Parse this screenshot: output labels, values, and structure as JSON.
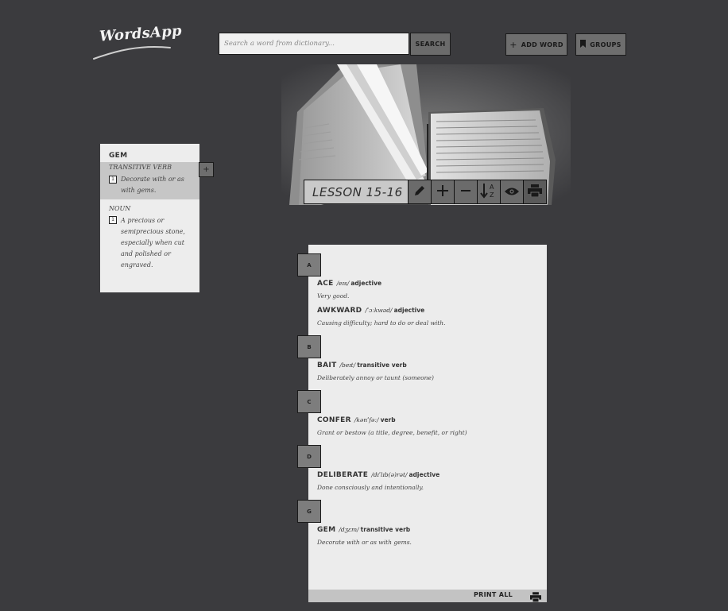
{
  "app": {
    "name": "WordsApp"
  },
  "search": {
    "placeholder": "Search a word from dictionary...",
    "button_label": "SEARCH"
  },
  "toolbar": {
    "add_word_label": "ADD WORD",
    "groups_label": "GROUPS"
  },
  "lesson": {
    "title": "LESSON 15-16",
    "actions": [
      "pencil-icon",
      "plus-icon",
      "minus-icon",
      "sort-az-icon",
      "eye-icon",
      "print-icon"
    ]
  },
  "popup": {
    "word": "GEM",
    "senses": [
      {
        "pos": "TRANSITIVE VERB",
        "num": "1",
        "definition": "Decorate with or as with gems."
      },
      {
        "pos": "NOUN",
        "num": "1",
        "definition": "A precious or semiprecious stone, especially when cut and polished or engraved."
      }
    ],
    "add_label": "+"
  },
  "word_list": {
    "sections": [
      {
        "letter": "A",
        "words": [
          {
            "word": "ACE",
            "pron": "/eɪs/",
            "pos": "adjective",
            "definition": "Very good."
          },
          {
            "word": "AWKWARD",
            "pron": "/ˈɔːkwəd/",
            "pos": "adjective",
            "definition": "Causing difficulty; hard to do or deal with."
          }
        ]
      },
      {
        "letter": "B",
        "words": [
          {
            "word": "BAIT",
            "pron": "/beɪt/",
            "pos": "transitive verb",
            "definition": "Deliberately annoy or taunt (someone)"
          }
        ]
      },
      {
        "letter": "C",
        "words": [
          {
            "word": "CONFER",
            "pron": "/kənˈfəː/",
            "pos": "verb",
            "definition": "Grant or bestow (a title, degree, benefit, or right)"
          }
        ]
      },
      {
        "letter": "D",
        "words": [
          {
            "word": "DELIBERATE",
            "pron": "/dɪˈlɪb(ə)rət/",
            "pos": "adjective",
            "definition": "Done consciously and intentionally."
          }
        ]
      },
      {
        "letter": "G",
        "words": [
          {
            "word": "GEM",
            "pron": "/dʒɛm/",
            "pos": "transitive verb",
            "definition": "Decorate with or as with gems."
          }
        ]
      }
    ],
    "print_all_label": "PRINT ALL"
  }
}
